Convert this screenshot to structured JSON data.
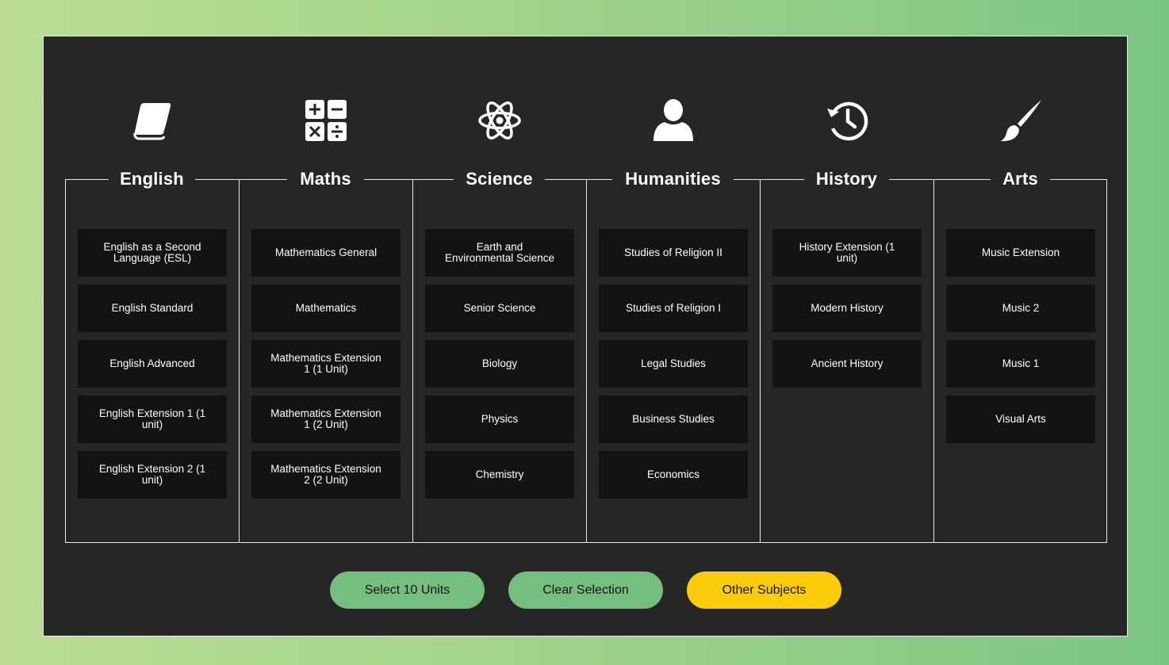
{
  "columns": [
    {
      "title": "English",
      "icon": "book-icon",
      "items": [
        "English as a Second Language (ESL)",
        "English Standard",
        "English Advanced",
        "English Extension 1 (1 unit)",
        "English Extension 2 (1 unit)"
      ]
    },
    {
      "title": "Maths",
      "icon": "calculator-icon",
      "items": [
        "Mathematics General",
        "Mathematics",
        "Mathematics Extension 1 (1 Unit)",
        "Mathematics Extension 1 (2 Unit)",
        "Mathematics Extension 2 (2 Unit)"
      ]
    },
    {
      "title": "Science",
      "icon": "atom-icon",
      "items": [
        "Earth and Environmental Science",
        "Senior Science",
        "Biology",
        "Physics",
        "Chemistry"
      ]
    },
    {
      "title": "Humanities",
      "icon": "person-icon",
      "items": [
        "Studies of Religion II",
        "Studies of Religion I",
        "Legal Studies",
        "Business Studies",
        "Economics"
      ]
    },
    {
      "title": "History",
      "icon": "history-icon",
      "items": [
        "History Extension (1 unit)",
        "Modern History",
        "Ancient History"
      ]
    },
    {
      "title": "Arts",
      "icon": "paintbrush-icon",
      "items": [
        "Music Extension",
        "Music 2",
        "Music 1",
        "Visual Arts"
      ]
    }
  ],
  "actions": {
    "select_label": "Select 10 Units",
    "clear_label": "Clear Selection",
    "other_label": "Other Subjects"
  },
  "colors": {
    "panel": "#262626",
    "tile": "#131313",
    "green_button": "#74bf7f",
    "yellow_button": "#fccc0a"
  }
}
